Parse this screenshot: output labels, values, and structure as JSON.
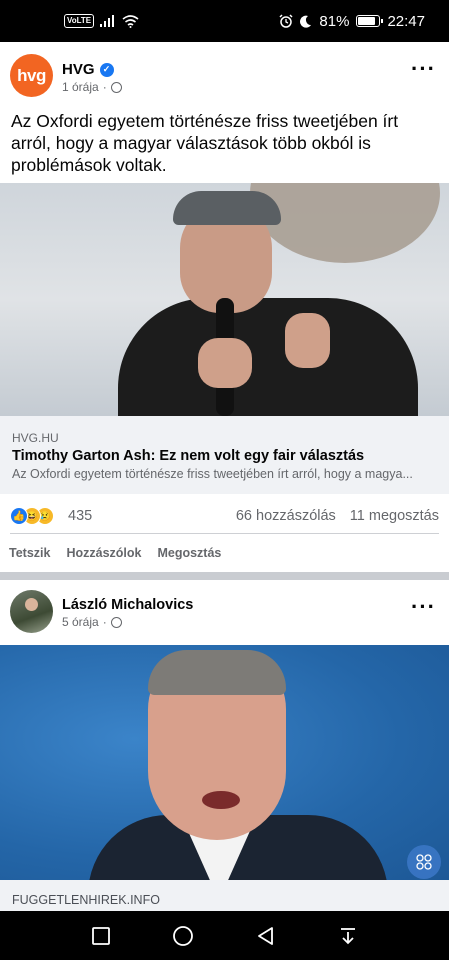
{
  "status_bar": {
    "volte": "VoLTE",
    "battery_percent": "81%",
    "battery_level": 0.81,
    "time": "22:47"
  },
  "post1": {
    "avatar_text": "hvg",
    "author": "HVG",
    "verified": true,
    "time": "1 órája",
    "text": "Az Oxfordi egyetem történésze friss tweetjében írt arról, hogy a magyar választások több okból is problémások voltak.",
    "link": {
      "domain": "HVG.HU",
      "title": "Timothy Garton Ash: Ez nem volt egy fair választás",
      "description": "Az Oxfordi egyetem történésze friss tweetjében írt arról, hogy a magya..."
    },
    "reaction_count": "435",
    "comments": "66 hozzászólás",
    "shares": "11 megosztás",
    "actions": {
      "like": "Tetszik",
      "comment": "Hozzászólok",
      "share": "Megosztás"
    }
  },
  "post2": {
    "author": "László Michalovics",
    "time": "5 órája",
    "link_domain": "FUGGETLENHIREK.INFO"
  },
  "colors": {
    "hvg_orange": "#f26522",
    "facebook_blue": "#1877f2",
    "secondary_text": "#65676b"
  }
}
